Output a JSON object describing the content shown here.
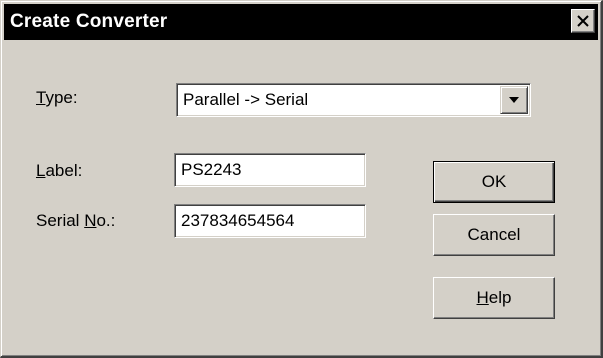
{
  "dialog": {
    "title": "Create Converter",
    "close_icon": "close-icon",
    "type": {
      "label_accel": "T",
      "label_rest": "ype:",
      "selected_value": "Parallel -> Serial"
    },
    "label_field": {
      "label_accel": "L",
      "label_rest": "abel:",
      "value": "PS2243"
    },
    "serial_field": {
      "label_pre": "Serial ",
      "label_accel": "N",
      "label_rest": "o.:",
      "value": "237834654564"
    },
    "buttons": {
      "ok": "OK",
      "cancel": "Cancel",
      "help_accel": "H",
      "help_rest": "elp"
    }
  }
}
